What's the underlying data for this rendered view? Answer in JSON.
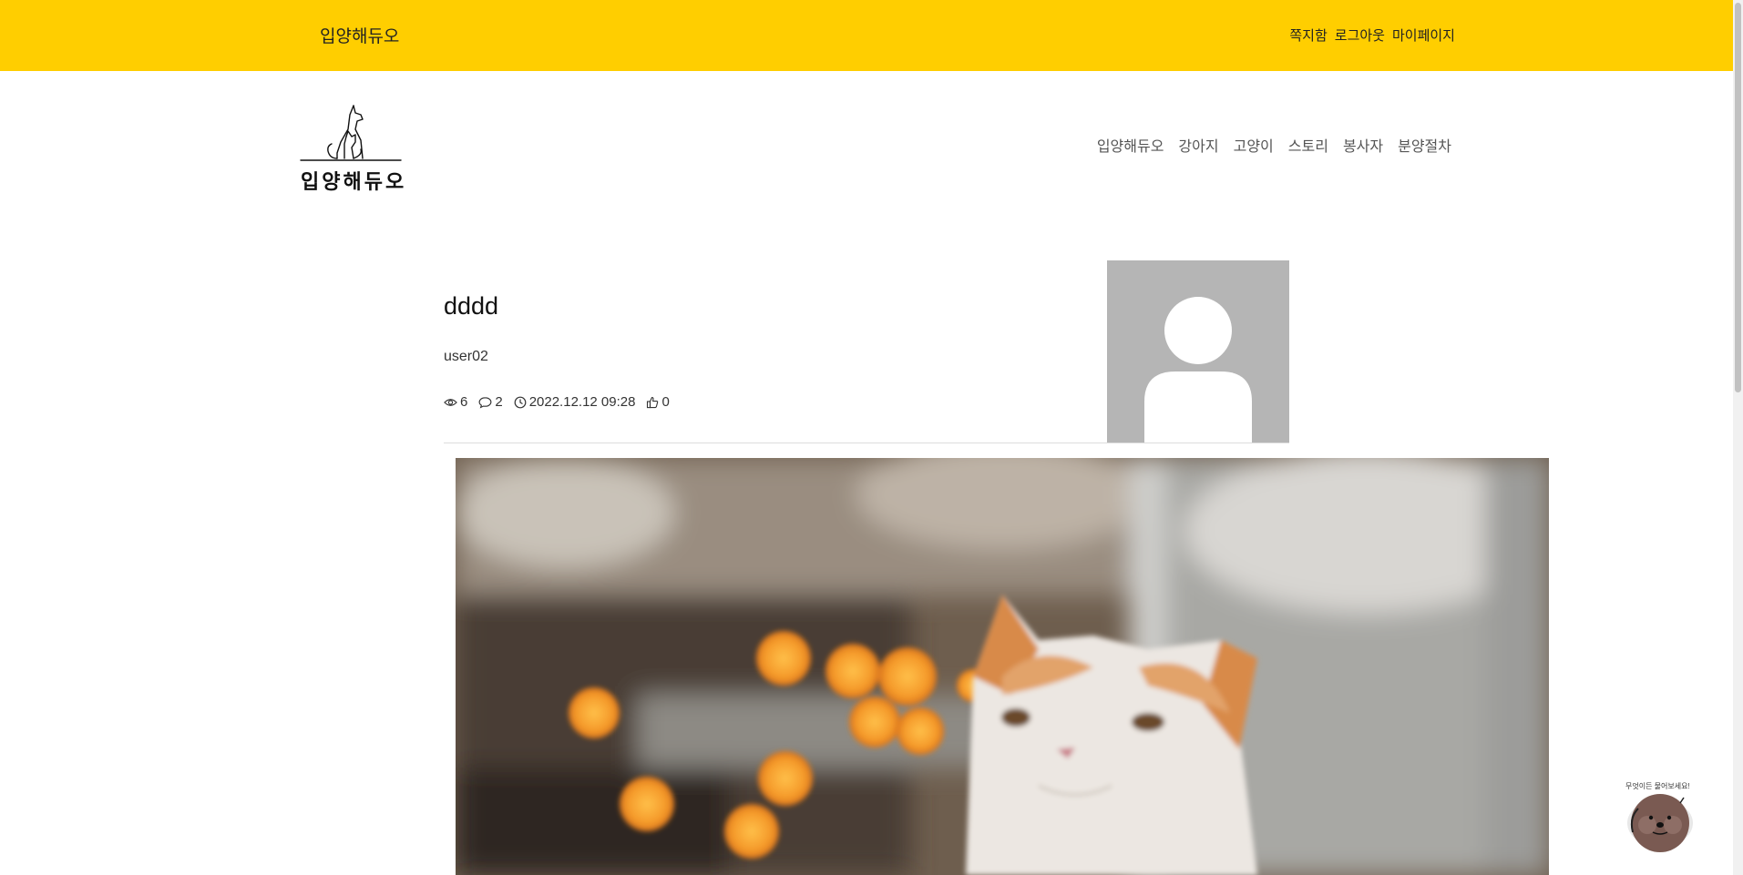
{
  "topbar": {
    "brand": "입양해듀오",
    "links": [
      "쪽지함",
      "로그아웃",
      "마이페이지"
    ],
    "bg_color": "#ffce00"
  },
  "logo": {
    "text": "입양해듀오"
  },
  "nav": {
    "items": [
      "입양해듀오",
      "강아지",
      "고양이",
      "스토리",
      "봉사자",
      "분양절차"
    ]
  },
  "post": {
    "title": "dddd",
    "author": "user02",
    "views": "6",
    "comments": "2",
    "date": "2022.12.12 09:28",
    "likes": "0"
  },
  "avatar": {
    "icon": "user-placeholder-icon"
  },
  "chatbot": {
    "bubble_text": "무엇이든 물어보세요!",
    "icon": "otter-chatbot-icon"
  }
}
